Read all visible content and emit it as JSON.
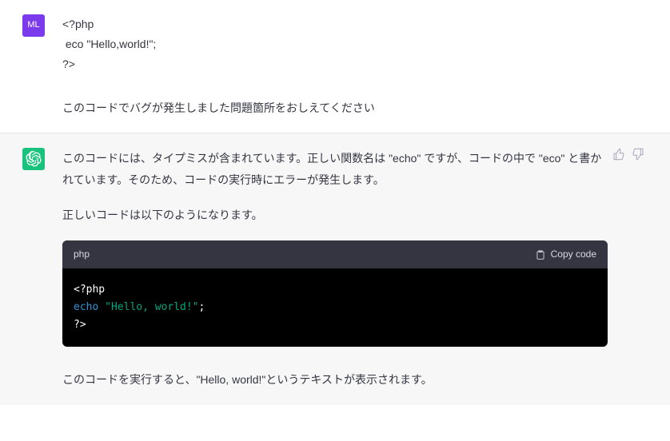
{
  "user": {
    "avatar_text": "ML",
    "code_lines": [
      "<?php",
      " eco \"Hello,world!\";",
      "?>"
    ],
    "question": "このコードでバグが発生しました問題箇所をおしえてください"
  },
  "assistant": {
    "para1": "このコードには、タイプミスが含まれています。正しい関数名は \"echo\" ですが、コードの中で \"eco\" と書かれています。そのため、コードの実行時にエラーが発生します。",
    "para2": "正しいコードは以下のようになります。",
    "code": {
      "language": "php",
      "copy_label": "Copy code",
      "line1_open": "<?php",
      "line2_keyword": "echo",
      "line2_string": "\"Hello, world!\"",
      "line2_semi": ";",
      "line3_close": "?>"
    },
    "para3": "このコードを実行すると、\"Hello, world!\"というテキストが表示されます。"
  }
}
